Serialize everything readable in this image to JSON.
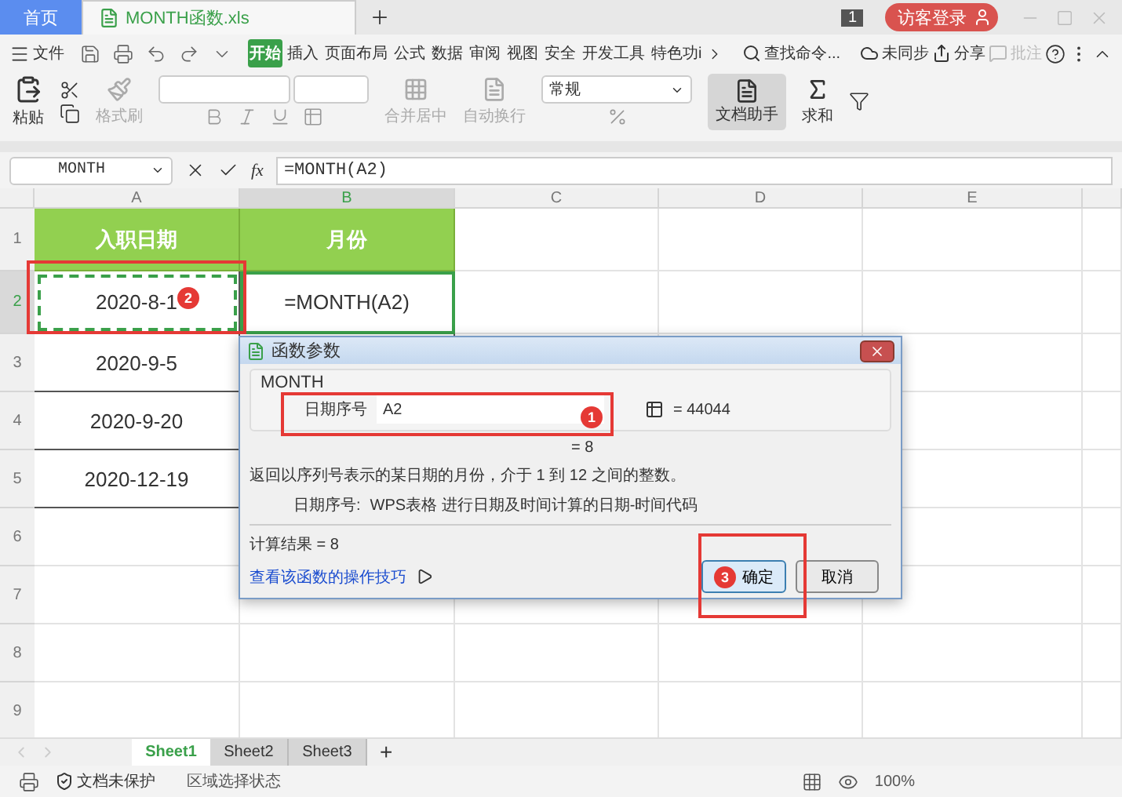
{
  "tabs": [
    {
      "label": "首页",
      "kind": "home",
      "selected": false
    },
    {
      "label": "MONTH函数.xls",
      "kind": "file",
      "selected": true
    }
  ],
  "notification_count": "1",
  "login_button": "访客登录",
  "menu": {
    "file": "文件",
    "items": [
      {
        "label": "开始",
        "selected": true
      },
      {
        "label": "插入",
        "selected": false
      },
      {
        "label": "页面布局",
        "selected": false
      },
      {
        "label": "公式",
        "selected": false
      },
      {
        "label": "数据",
        "selected": false
      },
      {
        "label": "审阅",
        "selected": false
      },
      {
        "label": "视图",
        "selected": false
      },
      {
        "label": "安全",
        "selected": false
      },
      {
        "label": "开发工具",
        "selected": false
      },
      {
        "label": "特色功i",
        "selected": false
      }
    ],
    "search": "查找命令...",
    "sync": "未同步",
    "share": "分享",
    "comment": {
      "label": "批注",
      "disabled": true
    }
  },
  "ribbon": {
    "paste": "粘贴",
    "format_painter": "格式刷",
    "merge": "合并居中",
    "wrap": "自动换行",
    "number_format": "常规",
    "doc_assistant": "文档助手",
    "sum": "求和"
  },
  "formula_bar": {
    "name_box": "MONTH",
    "fx_label": "fx",
    "formula": "=MONTH(A2)"
  },
  "sheet": {
    "columns": [
      {
        "label": "A",
        "selected": false
      },
      {
        "label": "B",
        "selected": true
      },
      {
        "label": "C",
        "selected": false
      },
      {
        "label": "D",
        "selected": false
      },
      {
        "label": "E",
        "selected": false
      }
    ],
    "rows": [
      {
        "header": "1",
        "kind": "heading",
        "selected": false,
        "cells": [
          "入职日期",
          "月份"
        ]
      },
      {
        "header": "2",
        "kind": "data",
        "selected": true,
        "cells": [
          "2020-8-1",
          "=MONTH(A2)"
        ]
      },
      {
        "header": "3",
        "kind": "data",
        "selected": false,
        "cells": [
          "2020-9-5",
          ""
        ]
      },
      {
        "header": "4",
        "kind": "data",
        "selected": false,
        "cells": [
          "2020-9-20",
          ""
        ]
      },
      {
        "header": "5",
        "kind": "data",
        "selected": false,
        "cells": [
          "2020-12-19",
          ""
        ]
      },
      {
        "header": "6",
        "kind": "empty",
        "selected": false,
        "cells": []
      },
      {
        "header": "7",
        "kind": "empty",
        "selected": false,
        "cells": []
      },
      {
        "header": "8",
        "kind": "empty",
        "selected": false,
        "cells": []
      },
      {
        "header": "9",
        "kind": "empty",
        "selected": false,
        "cells": []
      }
    ]
  },
  "dialog": {
    "title": "函数参数",
    "function": "MONTH",
    "argument_label": "日期序号",
    "argument_value": "A2",
    "argument_result": "= 44044",
    "formula_result": "= 8",
    "description": "返回以序列号表示的某日期的月份，介于 1 到 12 之间的整数。",
    "argument_help_label": "日期序号:",
    "argument_help": "WPS表格 进行日期及时间计算的日期-时间代码",
    "calc_result": "计算结果 = 8",
    "help_link": "查看该函数的操作技巧",
    "buttons": [
      {
        "label": "确定",
        "kind": "primary"
      },
      {
        "label": "取消",
        "kind": "secondary"
      }
    ]
  },
  "annotations": [
    "1",
    "2",
    "3"
  ],
  "sheet_tabs": [
    {
      "label": "Sheet1",
      "selected": true
    },
    {
      "label": "Sheet2",
      "selected": false
    },
    {
      "label": "Sheet3",
      "selected": false
    }
  ],
  "add_sheet": "+",
  "status_bar": {
    "protection": "文档未保护",
    "mode": "区域选择状态",
    "zoom": "100%"
  }
}
